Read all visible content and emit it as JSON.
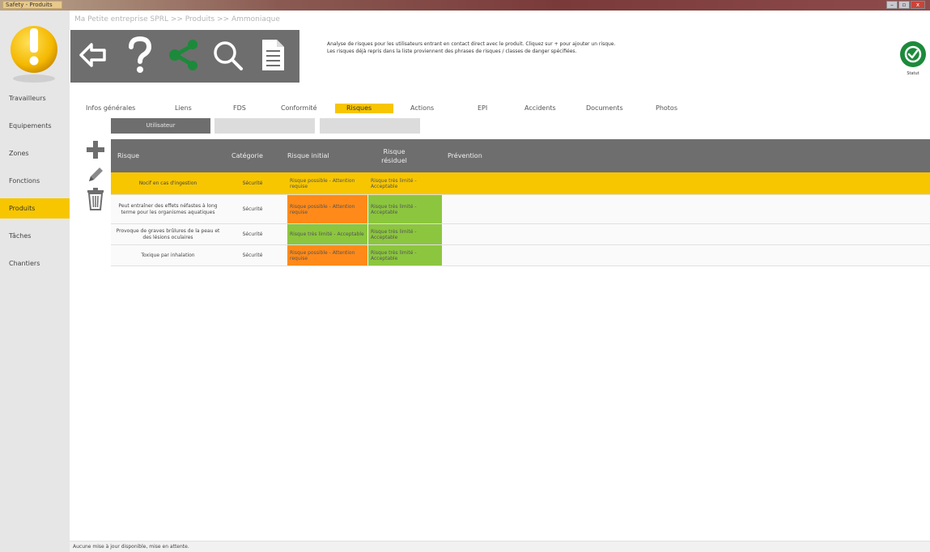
{
  "window": {
    "title": "Safety - Produits",
    "controls": [
      "–",
      "▫",
      "x"
    ]
  },
  "sidebar": {
    "items": [
      {
        "label": "Travailleurs",
        "active": false
      },
      {
        "label": "Equipements",
        "active": false
      },
      {
        "label": "Zones",
        "active": false
      },
      {
        "label": "Fonctions",
        "active": false
      },
      {
        "label": "Produits",
        "active": true
      },
      {
        "label": "Tâches",
        "active": false
      },
      {
        "label": "Chantiers",
        "active": false
      }
    ]
  },
  "breadcrumb": "Ma Petite entreprise SPRL >> Produits >> Ammoniaque",
  "toolbar": {
    "buttons": [
      "back-icon",
      "help-icon",
      "share-icon",
      "search-icon",
      "document-icon"
    ],
    "share_color": "#1c8a3a"
  },
  "description": {
    "line1": "Analyse de risques pour les utilisateurs entrant en contact direct avec le produit. Cliquez sur + pour ajouter un risque.",
    "line2": "Les risques déjà repris dans la liste proviennent des phrases de risques / classes de danger spécifiées."
  },
  "status": {
    "label": "Statut",
    "color": "#1c8a3a"
  },
  "tabs": [
    {
      "label": "Infos générales",
      "active": false
    },
    {
      "label": "Liens",
      "active": false
    },
    {
      "label": "FDS",
      "active": false
    },
    {
      "label": "Conformité",
      "active": false
    },
    {
      "label": "Risques",
      "active": true
    },
    {
      "label": "Actions",
      "active": false
    },
    {
      "label": "EPI",
      "active": false
    },
    {
      "label": "Accidents",
      "active": false
    },
    {
      "label": "Documents",
      "active": false
    },
    {
      "label": "Photos",
      "active": false
    }
  ],
  "subtabs": [
    "Utilisateur",
    "",
    ""
  ],
  "grid": {
    "columns": [
      "Risque",
      "Catégorie",
      "Risque initial",
      "Risque résiduel",
      "Prévention"
    ],
    "rows": [
      {
        "risque": "Nocif en cas d'ingestion",
        "categorie": "Sécurité",
        "initial": "Risque possible - Attention requise",
        "initial_level": "orange",
        "residuel": "Risque très limité - Acceptable",
        "residuel_level": "green",
        "selected": true
      },
      {
        "risque": "Peut entraîner des effets néfastes à long terme pour les organismes aquatiques",
        "categorie": "Sécurité",
        "initial": "Risque possible - Attention requise",
        "initial_level": "orange",
        "residuel": "Risque très limité - Acceptable",
        "residuel_level": "green",
        "selected": false
      },
      {
        "risque": "Provoque de graves brûlures de la peau et des lésions oculaires",
        "categorie": "Sécurité",
        "initial": "Risque très limité - Acceptable",
        "initial_level": "green",
        "residuel": "Risque très limité - Acceptable",
        "residuel_level": "green",
        "selected": false
      },
      {
        "risque": "Toxique par inhalation",
        "categorie": "Sécurité",
        "initial": "Risque possible - Attention requise",
        "initial_level": "orange",
        "residuel": "Risque très limité - Acceptable",
        "residuel_level": "green",
        "selected": false
      }
    ]
  },
  "colors": {
    "accent": "#f7c600",
    "orange": "#ff8a1a",
    "green": "#8cc63f",
    "dark_gray": "#6e6e6e"
  },
  "statusbar": "Aucune mise à jour disponible, mise en attente."
}
